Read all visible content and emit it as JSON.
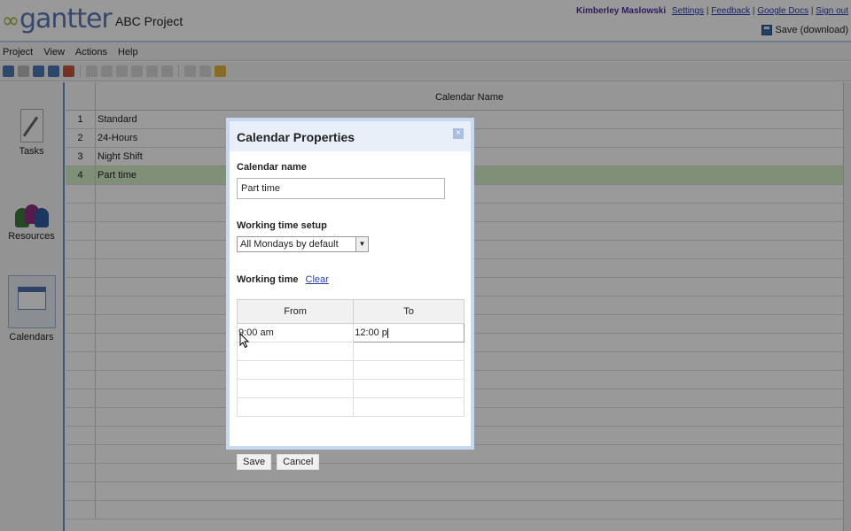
{
  "app": {
    "logo": "gantter",
    "project_name": "ABC Project"
  },
  "header": {
    "user": "Kimberley Maslowski",
    "links": [
      "Settings",
      "Feedback",
      "Google Docs",
      "Sign out"
    ],
    "separator": "|",
    "save_label": "Save (download)"
  },
  "menubar": [
    "Project",
    "View",
    "Actions",
    "Help"
  ],
  "nav": {
    "tasks": "Tasks",
    "resources": "Resources",
    "calendars": "Calendars"
  },
  "grid": {
    "column_header": "Calendar Name",
    "rows": [
      {
        "num": "1",
        "name": "Standard"
      },
      {
        "num": "2",
        "name": "24-Hours"
      },
      {
        "num": "3",
        "name": "Night Shift"
      },
      {
        "num": "4",
        "name": "Part time"
      }
    ]
  },
  "dialog": {
    "title": "Calendar Properties",
    "close_icon": "×",
    "name_label": "Calendar name",
    "name_value": "Part time",
    "setup_label": "Working time setup",
    "setup_value": "All Mondays by default",
    "working_time_label": "Working time",
    "clear_label": "Clear",
    "table_headers": [
      "From",
      "To"
    ],
    "rows": [
      {
        "from": "9:00 am",
        "to": "12:00 p"
      },
      {
        "from": "",
        "to": ""
      },
      {
        "from": "",
        "to": ""
      },
      {
        "from": "",
        "to": ""
      },
      {
        "from": "",
        "to": ""
      }
    ],
    "save_label": "Save",
    "cancel_label": "Cancel"
  },
  "colors": {
    "accent": "#5b7bb6",
    "selected_row": "#d6efc8",
    "link": "#2a3fb0"
  }
}
